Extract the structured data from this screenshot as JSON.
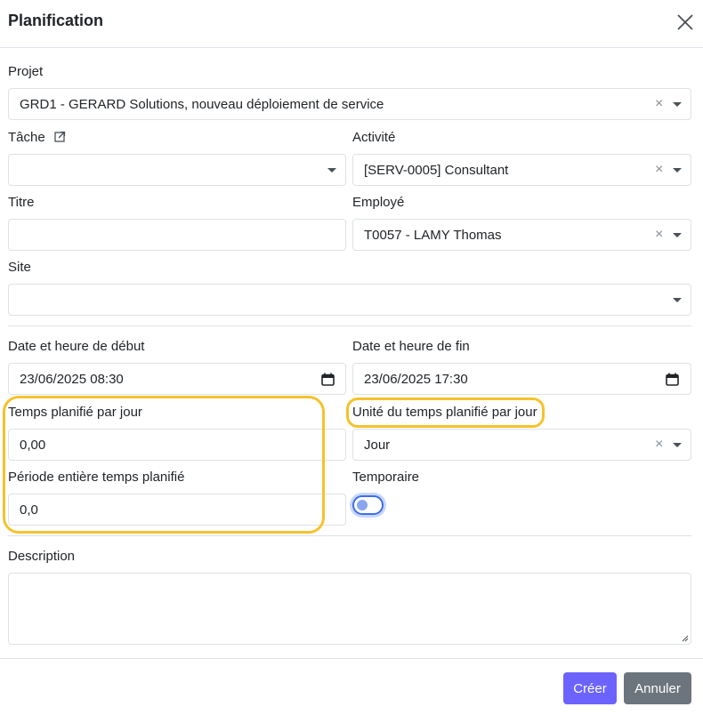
{
  "dialog": {
    "title": "Planification"
  },
  "form": {
    "project": {
      "label": "Projet",
      "value": "GRD1 - GERARD Solutions, nouveau déploiement de service"
    },
    "task": {
      "label": "Tâche",
      "value": ""
    },
    "activity": {
      "label": "Activité",
      "value": "[SERV-0005] Consultant"
    },
    "title_field": {
      "label": "Titre",
      "value": ""
    },
    "employee": {
      "label": "Employé",
      "value": "T0057 - LAMY Thomas"
    },
    "site": {
      "label": "Site",
      "value": ""
    },
    "start": {
      "label": "Date et heure de début",
      "value": "23/06/2025 08:30"
    },
    "end": {
      "label": "Date et heure de fin",
      "value": "23/06/2025 17:30"
    },
    "time_per_day": {
      "label": "Temps planifié par jour",
      "value": "0,00"
    },
    "time_unit": {
      "label": "Unité du temps planifié par jour",
      "value": "Jour"
    },
    "period_total": {
      "label": "Période entière temps planifié",
      "value": "0,0"
    },
    "temporary": {
      "label": "Temporaire",
      "checked": false
    },
    "description": {
      "label": "Description",
      "value": ""
    }
  },
  "footer": {
    "create_label": "Créer",
    "cancel_label": "Annuler"
  },
  "colors": {
    "highlight": "#f6c22c",
    "primary": "#6c63ff",
    "secondary": "#6c757d",
    "toggle": "#3d6ee8"
  }
}
